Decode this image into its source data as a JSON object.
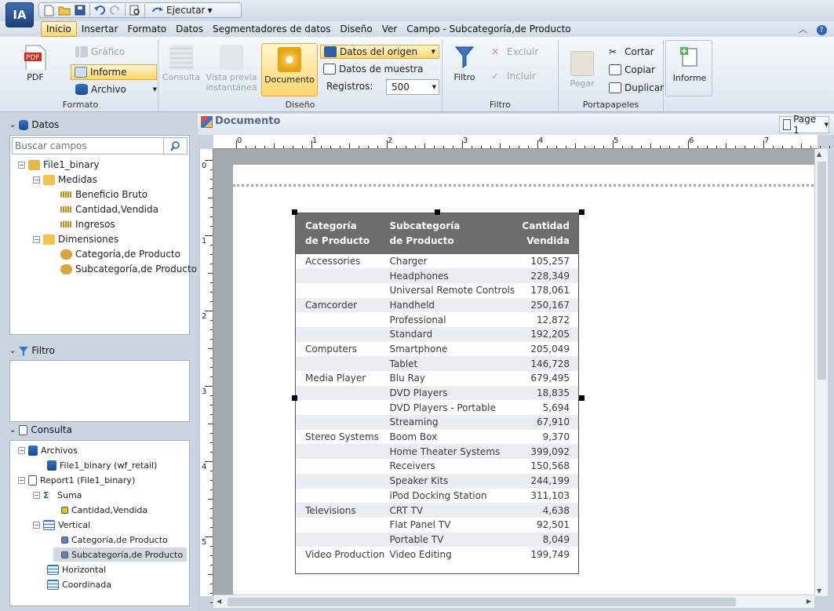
{
  "app": {
    "logo": "IA"
  },
  "qat": {
    "run_label": "Ejecutar"
  },
  "menu": [
    "Inicio",
    "Insertar",
    "Formato",
    "Datos",
    "Segmentadores de datos",
    "Diseño",
    "Ver",
    "Campo - Subcategoría,de Producto"
  ],
  "ribbon": {
    "formato": {
      "label": "Formato",
      "pdf": "PDF",
      "grafico": "Gráfico",
      "informe": "Informe",
      "archivo": "Archivo"
    },
    "diseno": {
      "label": "Diseño",
      "consulta": "Consulta",
      "vista_previa": "Vista previa instantánea",
      "documento": "Documento",
      "datos_origen": "Datos del origen",
      "datos_muestra": "Datos de muestra",
      "registros_label": "Registros:",
      "registros_value": "500"
    },
    "filtro": {
      "label": "Filtro",
      "filtro": "Filtro",
      "excluir": "Excluir",
      "incluir": "Incluir"
    },
    "portapapeles": {
      "label": "Portapapeles",
      "pegar": "Pegar",
      "cortar": "Cortar",
      "copiar": "Copiar",
      "duplicar": "Duplicar"
    },
    "informe": {
      "label": "Informe"
    }
  },
  "datos_panel": {
    "title": "Datos",
    "search_placeholder": "Buscar campos",
    "root": "File1_binary",
    "medidas": "Medidas",
    "medidas_items": [
      "Beneficio Bruto",
      "Cantidad,Vendida",
      "Ingresos"
    ],
    "dimensiones": "Dimensiones",
    "dimensiones_items": [
      "Categoría,de Producto",
      "Subcategoría,de Producto"
    ]
  },
  "filtro_panel": {
    "title": "Filtro"
  },
  "consulta_panel": {
    "title": "Consulta",
    "archivos": "Archivos",
    "archivo_item": "File1_binary (wf_retail)",
    "report": "Report1 (File1_binary)",
    "suma": "Suma",
    "suma_item": "Cantidad,Vendida",
    "vertical": "Vertical",
    "vertical_items": [
      "Categoría,de Producto",
      "Subcategoría,de Producto"
    ],
    "horizontal": "Horizontal",
    "coordinada": "Coordinada"
  },
  "document": {
    "title": "Documento",
    "page": "Page 1"
  },
  "ruler": {
    "h": [
      "0",
      "1",
      "2",
      "3",
      "4",
      "5",
      "6",
      "7"
    ],
    "v": [
      "0",
      "1",
      "2",
      "3",
      "4",
      "5"
    ]
  },
  "table": {
    "headers": [
      [
        "Categoría",
        "de Producto"
      ],
      [
        "Subcategoría",
        "de Producto"
      ],
      [
        "Cantidad",
        "Vendida"
      ]
    ],
    "rows": [
      [
        "Accessories",
        "Charger",
        "105,257"
      ],
      [
        "",
        "Headphones",
        "228,349"
      ],
      [
        "",
        "Universal Remote Controls",
        "178,061"
      ],
      [
        "Camcorder",
        "Handheld",
        "250,167"
      ],
      [
        "",
        "Professional",
        "12,872"
      ],
      [
        "",
        "Standard",
        "192,205"
      ],
      [
        "Computers",
        "Smartphone",
        "205,049"
      ],
      [
        "",
        "Tablet",
        "146,728"
      ],
      [
        "Media Player",
        "Blu Ray",
        "679,495"
      ],
      [
        "",
        "DVD Players",
        "18,835"
      ],
      [
        "",
        "DVD Players - Portable",
        "5,694"
      ],
      [
        "",
        "Streaming",
        "67,910"
      ],
      [
        "Stereo Systems",
        "Boom Box",
        "9,370"
      ],
      [
        "",
        "Home Theater Systems",
        "399,092"
      ],
      [
        "",
        "Receivers",
        "150,568"
      ],
      [
        "",
        "Speaker Kits",
        "244,199"
      ],
      [
        "",
        "iPod Docking Station",
        "311,103"
      ],
      [
        "Televisions",
        "CRT TV",
        "4,638"
      ],
      [
        "",
        "Flat Panel TV",
        "92,501"
      ],
      [
        "",
        "Portable TV",
        "8,049"
      ],
      [
        "Video Production",
        "Video Editing",
        "199,749"
      ]
    ]
  }
}
